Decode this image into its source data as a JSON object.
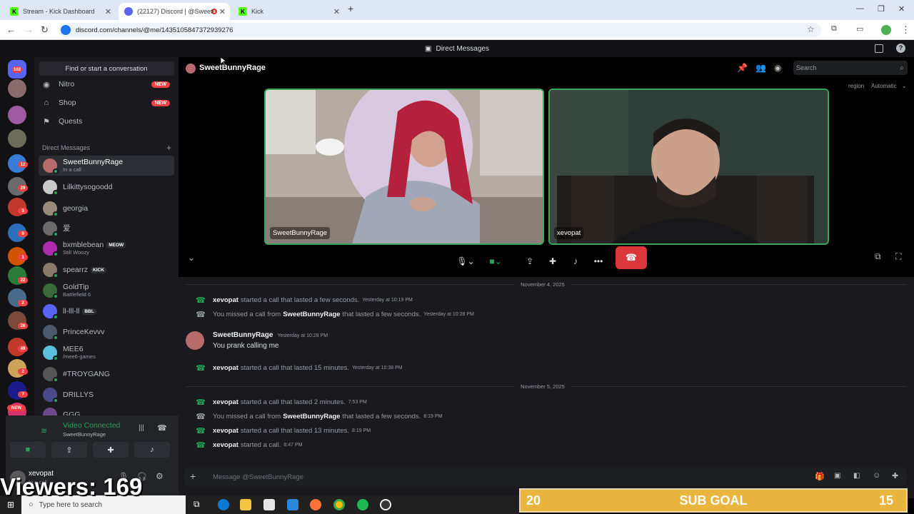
{
  "browser": {
    "tabs": [
      {
        "label": "Stream - Kick Dashboard",
        "active": false
      },
      {
        "label": "(22127) Discord | @SweetB",
        "active": true
      },
      {
        "label": "Kick",
        "active": false
      }
    ],
    "new_tab": "+",
    "url": "discord.com/channels/@me/1435105847372939276"
  },
  "discord": {
    "top_title": "Direct Messages",
    "find_placeholder": "Find or start a conversation",
    "nav": [
      {
        "label": "Nitro",
        "badge": "NEW",
        "icon": "nitro-icon"
      },
      {
        "label": "Shop",
        "badge": "NEW",
        "icon": "shop-icon"
      },
      {
        "label": "Quests",
        "badge": "",
        "icon": "quests-icon"
      }
    ],
    "dm_header": "Direct Messages",
    "dms": [
      {
        "name": "SweetBunnyRage",
        "sub": "In a call",
        "tag": "",
        "selected": true,
        "color": "#b76b6b"
      },
      {
        "name": "Lilkittysogoodd",
        "sub": "",
        "tag": "",
        "selected": false,
        "color": "#c9c9c9"
      },
      {
        "name": "georgia",
        "sub": "",
        "tag": "",
        "selected": false,
        "color": "#9a8a7a"
      },
      {
        "name": "爱",
        "sub": "",
        "tag": "",
        "selected": false,
        "color": "#6a6a6a"
      },
      {
        "name": "bxmblebean",
        "sub": "Still Woozy",
        "tag": "MEOW",
        "selected": false,
        "color": "#b02bb0"
      },
      {
        "name": "spearrz",
        "sub": "",
        "tag": "KICK",
        "selected": false,
        "color": "#8a7a6a"
      },
      {
        "name": "GoldTip",
        "sub": "Battlefield 6",
        "tag": "",
        "selected": false,
        "color": "#3a6a3a"
      },
      {
        "name": "ll-lll-ll",
        "sub": "",
        "tag": "BBL",
        "selected": false,
        "color": "#5865f2"
      },
      {
        "name": "PrinceKevvv",
        "sub": "",
        "tag": "",
        "selected": false,
        "color": "#4a5a6a"
      },
      {
        "name": "MEE6",
        "sub": "/mee6-games",
        "tag": "",
        "selected": false,
        "color": "#5bc0de"
      },
      {
        "name": "#TROYGANG",
        "sub": "",
        "tag": "",
        "selected": false,
        "color": "#555"
      },
      {
        "name": "DRILLYS",
        "sub": "",
        "tag": "",
        "selected": false,
        "color": "#4a4a8a"
      },
      {
        "name": "GGG",
        "sub": "",
        "tag": "",
        "selected": false,
        "color": "#6a4a8a"
      }
    ],
    "guild_badges": [
      "102",
      "12",
      "29",
      "3",
      "9",
      "1",
      "22",
      "2",
      "26",
      "49",
      "2",
      "7",
      "NEW"
    ],
    "voice": {
      "status": "Video Connected",
      "channel": "SweetBunnyRage",
      "user": "xevopat",
      "user_status": "In a call"
    },
    "call": {
      "title": "SweetBunnyRage",
      "search_placeholder": "Search",
      "region_label": "region",
      "region_value": "Automatic",
      "participants": [
        {
          "name": "SweetBunnyRage"
        },
        {
          "name": "xevopat"
        }
      ]
    },
    "chat": {
      "dates": [
        "November 4, 2025",
        "November 5, 2025"
      ],
      "messages": [
        {
          "kind": "started",
          "user": "xevopat",
          "text": "started a call that lasted a few seconds.",
          "time": "Yesterday at 10:19 PM"
        },
        {
          "kind": "missed",
          "pre": "You missed a call from",
          "user": "SweetBunnyRage",
          "text": "that lasted a few seconds.",
          "time": "Yesterday at 10:28 PM"
        },
        {
          "kind": "user",
          "user": "SweetBunnyRage",
          "time": "Yesterday at 10:28 PM",
          "text": "You prank calling me"
        },
        {
          "kind": "started",
          "user": "xevopat",
          "text": "started a call that lasted 15 minutes.",
          "time": "Yesterday at 10:38 PM"
        },
        {
          "kind": "started",
          "user": "xevopat",
          "text": "started a call that lasted 2 minutes.",
          "time": "7:53 PM"
        },
        {
          "kind": "missed",
          "pre": "You missed a call from",
          "user": "SweetBunnyRage",
          "text": "that lasted a few seconds.",
          "time": "8:19 PM"
        },
        {
          "kind": "started",
          "user": "xevopat",
          "text": "started a call that lasted 13 minutes.",
          "time": "8:19 PM"
        },
        {
          "kind": "started",
          "user": "xevopat",
          "text": "started a call.",
          "time": "8:47 PM"
        }
      ],
      "input_placeholder": "Message @SweetBunnyRage"
    }
  },
  "overlay": {
    "viewers": "Viewers: 169",
    "sub_goal_current": "20",
    "sub_goal_label": "SUB GOAL",
    "sub_goal_target": "15"
  },
  "taskbar": {
    "search_placeholder": "Type here to search"
  },
  "colors": {
    "discord_bg": "#1a1a1e",
    "call_green": "#23a55a",
    "hangup_red": "#da373c",
    "goal_gold": "#e9b53f"
  }
}
